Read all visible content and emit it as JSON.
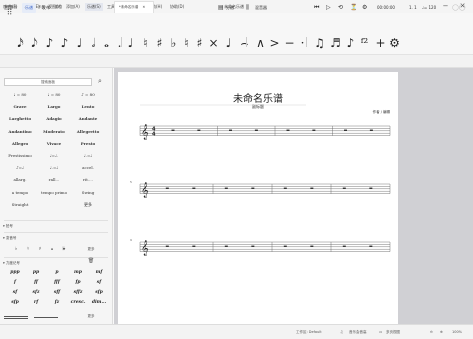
{
  "menu": {
    "items": [
      "文件(F)",
      "编辑(E)",
      "视图(V)",
      "添加(A)",
      "乐谱(S)",
      "工具(T)",
      "插件(P)",
      "帮助(H)",
      "协助(D)"
    ],
    "active_index": 4,
    "doc_title": "未命名乐谱"
  },
  "window": {
    "minimize": "−",
    "close": "✕"
  },
  "toolbar1": {
    "home": "主页",
    "score": "乐谱",
    "publish": "发布",
    "parts": "分谱",
    "mixer": "混音器",
    "playtime": "00:00:00",
    "bar_beat": "1. 1",
    "tempo": "♩= 120"
  },
  "toolbar2": {
    "notes": [
      "𝅘𝅥𝅯",
      "𝅘𝅥𝅮",
      "♪",
      "♪",
      "♩",
      "𝅗𝅥",
      "𝅝",
      ".",
      "♩",
      "♮",
      "♯",
      "♭",
      "♮",
      "♯",
      "×",
      "♩",
      "⌢",
      "∧",
      ">",
      "−",
      "·",
      "♫",
      "♬",
      "♪",
      "ᶠ²",
      "+",
      "⚙"
    ]
  },
  "tabs": {
    "side": [
      "符号面板",
      "乐器",
      "属性"
    ],
    "doc": "*未命名乐谱"
  },
  "panel": {
    "search_placeholder": "搜索面板",
    "tempo_rows": [
      [
        "♩ = 80",
        "♩ = 80",
        "♪ = 80"
      ],
      [
        "Grave",
        "Largo",
        "Lento"
      ],
      [
        "Larghetto",
        "Adagio",
        "Andante"
      ],
      [
        "Andantino",
        "Moderato",
        "Allegretto"
      ],
      [
        "Allegro",
        "Vivace",
        "Presto"
      ],
      [
        "Prestissimo",
        "♩=♩.",
        "♩.=♩"
      ],
      [
        "♪=♩",
        "♩.=♩",
        "accel."
      ],
      [
        "allarg.",
        "rall...",
        "rit...."
      ],
      [
        "a tempo",
        "tempo primo",
        "Swing"
      ],
      [
        "Straight",
        "",
        "更多"
      ]
    ],
    "sections": [
      "拍号",
      "变音号",
      "力度记号"
    ],
    "key_row": [
      "♭",
      "♮",
      "♯",
      "𝄪",
      "𝄫"
    ],
    "dynamics": [
      [
        "ppp",
        "pp",
        "p",
        "mp",
        "mf"
      ],
      [
        "f",
        "ff",
        "fff",
        "fp",
        "sf"
      ],
      [
        "sf",
        "sfz",
        "sff",
        "sffz",
        "sfp"
      ],
      [
        "sfp",
        "rf",
        "fz",
        "cresc.",
        "dim..."
      ]
    ],
    "more": "更多"
  },
  "score": {
    "title": "未命名乐谱",
    "subtitle": "副标题",
    "composer": "作者 / 编辑",
    "measures": [
      "5",
      "9"
    ]
  },
  "status": {
    "workspace": "工作区: Default",
    "concert_pitch": "音乐会音高",
    "view_mode": "多页视图",
    "zoom": "100%"
  }
}
